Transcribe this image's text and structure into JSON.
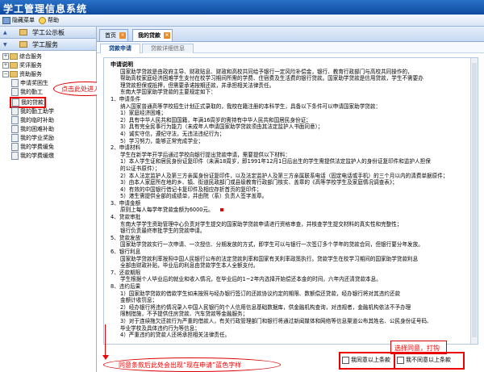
{
  "app": {
    "title": "学工管理信息系统"
  },
  "toolbar": {
    "switch_menu": "隐藏菜单",
    "help": "帮助"
  },
  "sidebar": {
    "sections": [
      {
        "label": "学工公示板"
      },
      {
        "label": "学工服务"
      }
    ],
    "tree": [
      {
        "label": "综合服务",
        "level": 0,
        "expanded": false
      },
      {
        "label": "奖评服务",
        "level": 0,
        "expanded": false
      },
      {
        "label": "资助服务",
        "level": 0,
        "expanded": true
      },
      {
        "label": "申请奖困生",
        "level": 1
      },
      {
        "label": "我的勤工",
        "level": 1
      },
      {
        "label": "我的贷款",
        "level": 1,
        "selected": true
      },
      {
        "label": "我的勤工助学",
        "level": 1
      },
      {
        "label": "我的临时补助",
        "level": 1
      },
      {
        "label": "我的困难补助",
        "level": 1
      },
      {
        "label": "我的学业奖励",
        "level": 1
      },
      {
        "label": "我的学费缓免",
        "level": 1
      },
      {
        "label": "我的学费缓缴",
        "level": 1
      }
    ]
  },
  "annotations": {
    "click_here": "点击此处进入",
    "bottom_note": "同意条款后此处会出现“现在申请”蓝色字样",
    "agree_note": "选择同意，打钩"
  },
  "tabs": [
    {
      "label": "首页",
      "active": false
    },
    {
      "label": "我的贷款",
      "active": true
    }
  ],
  "subtabs": [
    {
      "label": "贷款申请",
      "active": true
    },
    {
      "label": "贷款详细信息",
      "active": false
    }
  ],
  "document": {
    "heading": "申请说明",
    "paragraphs": [
      "国家助学贷款是由政府主导、财政贴息、财政和高校共同给予银行一定风险补偿金，银行、教育行政部门与高校共同操作的，",
      "帮助高校家庭经济困难学生支付在校学习期间所需的学费、住宿费及生活费的银行贷款。国家助学贷款是信用贷款，学生不需要办",
      "理贷款担保或抵押，但需要承诺按期还款，并承担相关法律责任。",
      "东南大学国家助学贷款的主要规定如下：",
      "1、申请条件",
      "纳入国家普通高等学校招生计划正式录取的，我校在籍注册的本科学生，具备以下条件可以申请国家助学贷款：",
      "1）家庭经济困难；",
      "2）具有中华人民共和国国籍，年满16周岁的需持有中华人民共和国居民身份证；",
      "3）具有完全民事行为能力（未成年人申请国家助学贷款须由其法定监护人书面同意）；",
      "4）诚实守信，遵纪守法，无违法违纪行为；",
      "5）学习努力，能够正常完成学业；",
      "2、申请材料",
      "学生在新学年开学后通过学校向银行提出贷款申请，需要提供以下材料：",
      "1）本人学生证和居民身份证复印件（未满18周岁，即1991年12月1日后出生的学生需提供法定监护人的身份证复印件和监护人担保",
      "的公证书原件）；",
      "2）本人法定监护人及第三方亲属身份证复印件，以及法定监护人及第三方亲属联系电话（固定电话或手机）的三个月以内的清费单据原件；",
      "3）由本人家庭所在地的乡、镇、街道民政部门或县级教育行政部门核实、盖章的《高等学校学生及家庭情况调查表》；",
      "4）有效的中国银行借记卡复印件及相应存折首页的复印件；",
      "5）港生需提供全部的成绩单，并由院（系）负责人签字盖章。",
      "3、申请金额",
      "原则上每人每学年贷款金额为6000元。",
      "4、贷款审批",
      "东南大学学生资助管理中心负责对学生提交的国家助学贷款申请进行资格审查，并核查学生提交材料的真实性和完整性；",
      "银行负责最终审批学生的贷款申请。",
      "5、贷款发放",
      "国家助学贷款实行一次申请、一次授信、分期发放的方式，即学生可以与银行一次签订多个学年的贷款合同，但银行要分年发放。",
      "6、银行利息",
      "国家助学贷款利率按照中国人民银行公布的法定贷款利率和国家有关利率政策执行。贷款学生在校学习期间的国家助学贷款利息",
      "全部由财政补贴，毕业后的利息由贷款学生本人全额支付。",
      "7、还款期限",
      "学生根据个人毕业后的就业和收入情况，在毕业后的1~2年内选择开始偿还本金的时间，六年内还清贷款本息。",
      "8、违约后果",
      "1）国家助学贷款的借款学生如未按照与经办银行签订的还款协议约定的期限、数额偿还贷款，经办银行将对其违约还款",
      "金额计收罚息；",
      "2）经办银行将违约情况录入中国人民银行的个人信用信息基础数据库，供金融机构查询，对违规者，金融机构依法不予办理",
      "限制措施，不予提供住房贷款、汽车贷款等金融服务；",
      "3）对于连续拖欠还款行为严重的借款人，有关行政管理部门和银行将通过新闻媒体和网络等信息渠道公布其姓名、公民身份证号码、",
      "毕业学校及具体违约行为等信息；",
      "4）严重违约的贷款人还将承担相关法律责任。"
    ]
  },
  "agreement": {
    "agree_label": "我同意以上条款",
    "disagree_label": "我不同意以上条款"
  },
  "icons": {
    "close": "close-icon",
    "folder": "folder-icon",
    "document": "document-icon"
  },
  "colors": {
    "accent": "#0e4a9e",
    "alert": "#e00000"
  }
}
